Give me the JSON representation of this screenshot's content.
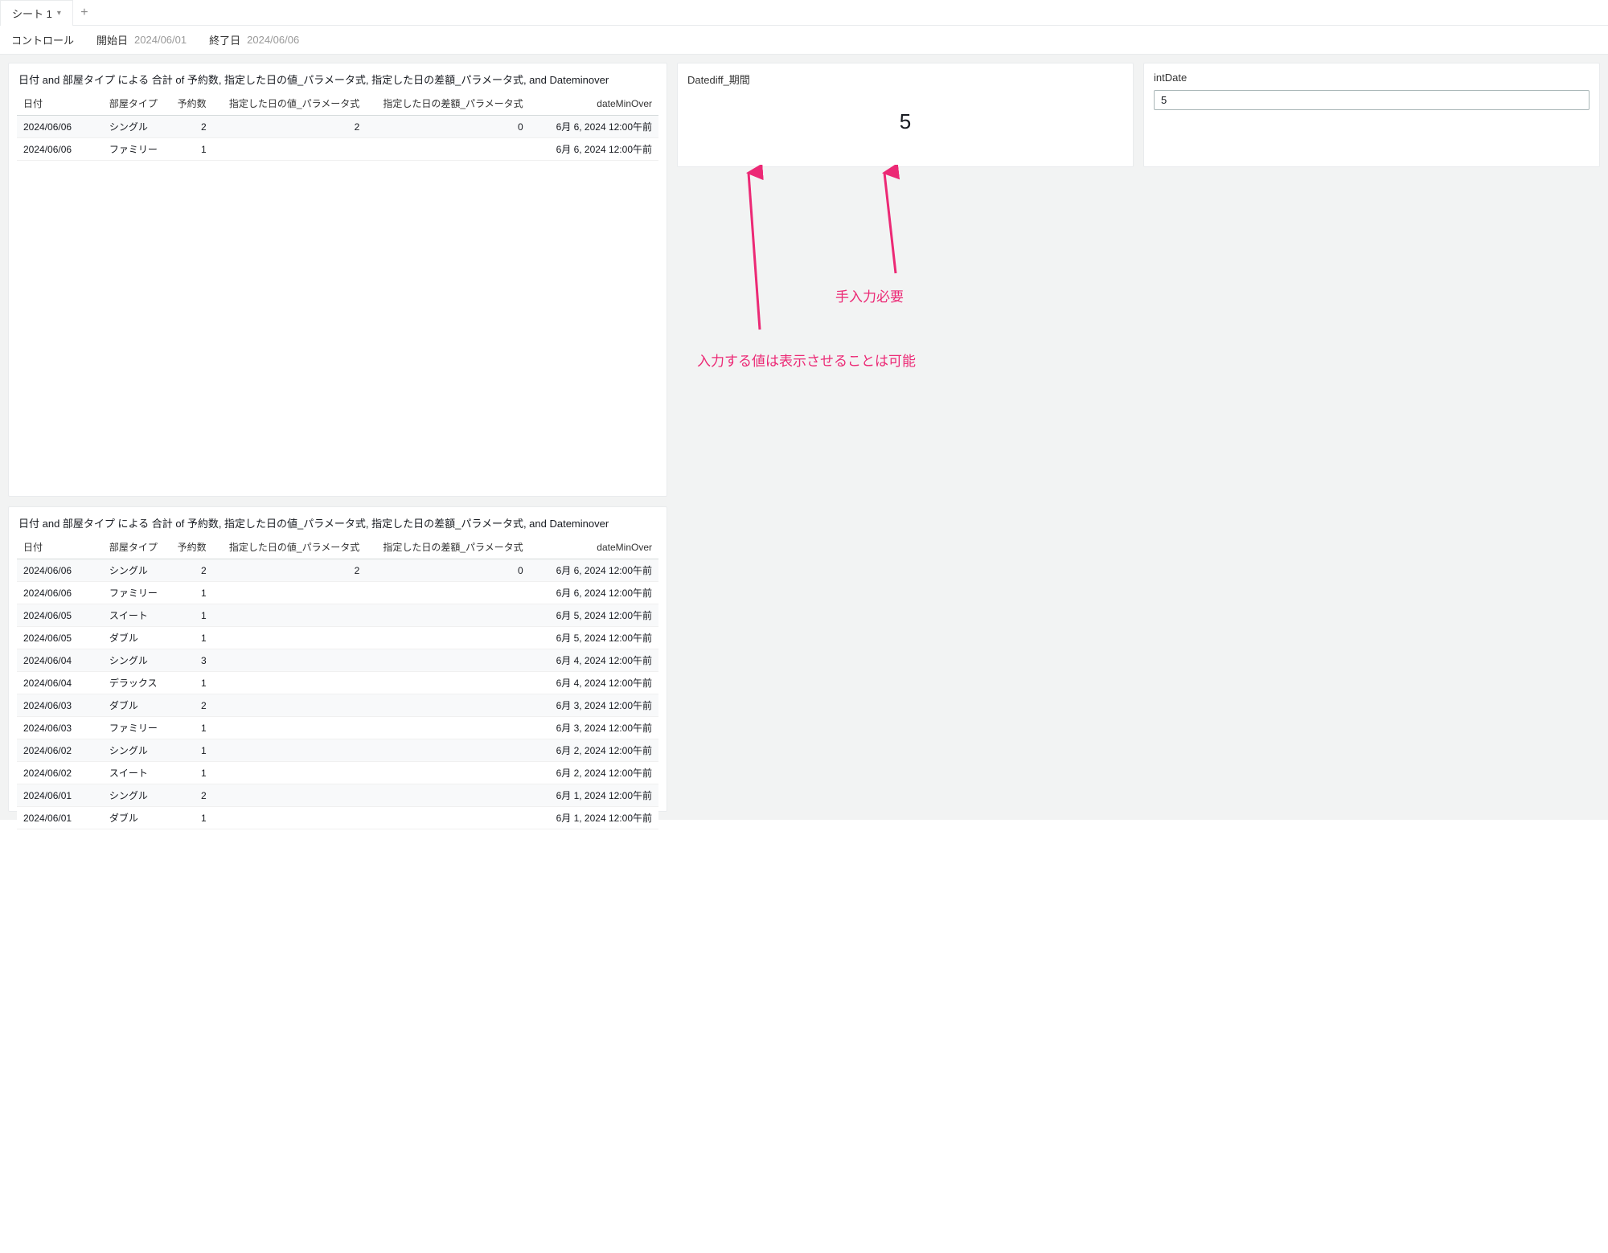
{
  "tabs": {
    "sheet1_label": "シート 1"
  },
  "controls": {
    "controls_label": "コントロール",
    "start_label": "開始日",
    "start_value": "2024/06/01",
    "end_label": "終了日",
    "end_value": "2024/06/06"
  },
  "table1": {
    "title": "日付 and 部屋タイプ による 合計 of 予約数, 指定した日の値_パラメータ式, 指定した日の差額_パラメータ式, and Dateminover",
    "headers": {
      "date": "日付",
      "room_type": "部屋タイプ",
      "reservations": "予約数",
      "param_value": "指定した日の値_パラメータ式",
      "param_diff": "指定した日の差額_パラメータ式",
      "date_min_over": "dateMinOver"
    },
    "rows": [
      {
        "date": "2024/06/06",
        "room_type": "シングル",
        "reservations": "2",
        "param_value": "2",
        "param_diff": "0",
        "date_min_over": "6月 6, 2024 12:00午前"
      },
      {
        "date": "2024/06/06",
        "room_type": "ファミリー",
        "reservations": "1",
        "param_value": "",
        "param_diff": "",
        "date_min_over": "6月 6, 2024 12:00午前"
      }
    ]
  },
  "table2": {
    "title": "日付 and 部屋タイプ による 合計 of 予約数, 指定した日の値_パラメータ式, 指定した日の差額_パラメータ式, and Dateminover",
    "headers": {
      "date": "日付",
      "room_type": "部屋タイプ",
      "reservations": "予約数",
      "param_value": "指定した日の値_パラメータ式",
      "param_diff": "指定した日の差額_パラメータ式",
      "date_min_over": "dateMinOver"
    },
    "rows": [
      {
        "date": "2024/06/06",
        "room_type": "シングル",
        "reservations": "2",
        "param_value": "2",
        "param_diff": "0",
        "date_min_over": "6月 6, 2024 12:00午前"
      },
      {
        "date": "2024/06/06",
        "room_type": "ファミリー",
        "reservations": "1",
        "param_value": "",
        "param_diff": "",
        "date_min_over": "6月 6, 2024 12:00午前"
      },
      {
        "date": "2024/06/05",
        "room_type": "スイート",
        "reservations": "1",
        "param_value": "",
        "param_diff": "",
        "date_min_over": "6月 5, 2024 12:00午前"
      },
      {
        "date": "2024/06/05",
        "room_type": "ダブル",
        "reservations": "1",
        "param_value": "",
        "param_diff": "",
        "date_min_over": "6月 5, 2024 12:00午前"
      },
      {
        "date": "2024/06/04",
        "room_type": "シングル",
        "reservations": "3",
        "param_value": "",
        "param_diff": "",
        "date_min_over": "6月 4, 2024 12:00午前"
      },
      {
        "date": "2024/06/04",
        "room_type": "デラックス",
        "reservations": "1",
        "param_value": "",
        "param_diff": "",
        "date_min_over": "6月 4, 2024 12:00午前"
      },
      {
        "date": "2024/06/03",
        "room_type": "ダブル",
        "reservations": "2",
        "param_value": "",
        "param_diff": "",
        "date_min_over": "6月 3, 2024 12:00午前"
      },
      {
        "date": "2024/06/03",
        "room_type": "ファミリー",
        "reservations": "1",
        "param_value": "",
        "param_diff": "",
        "date_min_over": "6月 3, 2024 12:00午前"
      },
      {
        "date": "2024/06/02",
        "room_type": "シングル",
        "reservations": "1",
        "param_value": "",
        "param_diff": "",
        "date_min_over": "6月 2, 2024 12:00午前"
      },
      {
        "date": "2024/06/02",
        "room_type": "スイート",
        "reservations": "1",
        "param_value": "",
        "param_diff": "",
        "date_min_over": "6月 2, 2024 12:00午前"
      },
      {
        "date": "2024/06/01",
        "room_type": "シングル",
        "reservations": "2",
        "param_value": "",
        "param_diff": "",
        "date_min_over": "6月 1, 2024 12:00午前"
      },
      {
        "date": "2024/06/01",
        "room_type": "ダブル",
        "reservations": "1",
        "param_value": "",
        "param_diff": "",
        "date_min_over": "6月 1, 2024 12:00午前"
      }
    ]
  },
  "kpi": {
    "datediff_title": "Datediff_期間",
    "datediff_value": "5",
    "intdate_title": "intDate",
    "intdate_value": "5"
  },
  "annotations": {
    "ann1": "入力する値は表示させることは可能",
    "ann2": "手入力必要"
  }
}
